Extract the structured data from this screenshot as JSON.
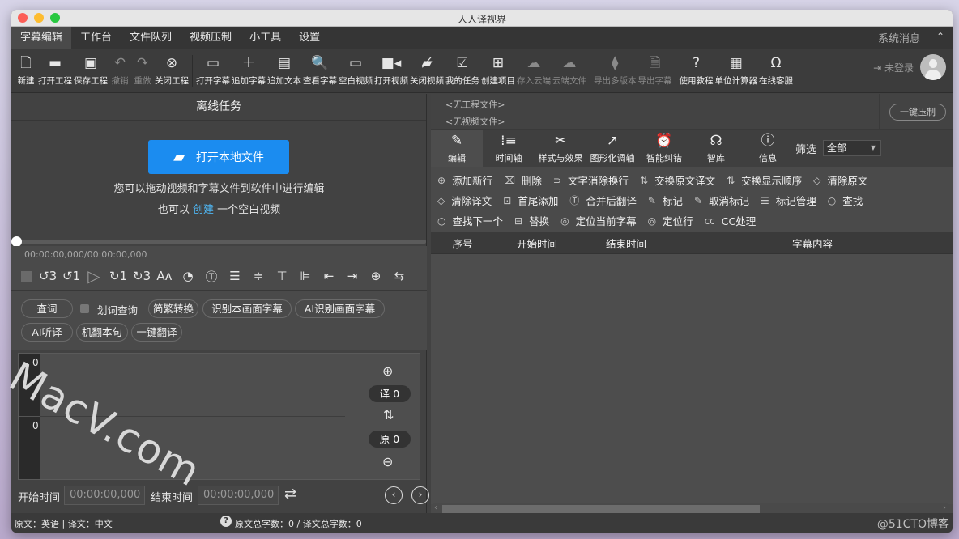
{
  "window": {
    "title": "人人译视界"
  },
  "menubar": {
    "items": [
      "字幕编辑",
      "工作台",
      "文件队列",
      "视频压制",
      "小工具",
      "设置"
    ],
    "active": "字幕编辑",
    "system_message": "系统消息",
    "collapse_icon": "chevron-up"
  },
  "toolbar": {
    "items": [
      {
        "label": "新建",
        "icon": "new-file",
        "enabled": true
      },
      {
        "label": "打开工程",
        "icon": "folder",
        "enabled": true
      },
      {
        "label": "保存工程",
        "icon": "save",
        "enabled": true
      },
      {
        "label": "撤销",
        "icon": "undo",
        "enabled": false
      },
      {
        "label": "重做",
        "icon": "redo",
        "enabled": false
      },
      {
        "label": "关闭工程",
        "icon": "close-circle",
        "enabled": true
      },
      {
        "label": "打开字幕",
        "icon": "folder-open",
        "enabled": true
      },
      {
        "label": "追加字幕",
        "icon": "plus",
        "enabled": true
      },
      {
        "label": "追加文本",
        "icon": "document",
        "enabled": true
      },
      {
        "label": "查看字幕",
        "icon": "search-doc",
        "enabled": true
      },
      {
        "label": "空白视频",
        "icon": "blank-screen",
        "enabled": true
      },
      {
        "label": "打开视频",
        "icon": "video-camera",
        "enabled": true
      },
      {
        "label": "关闭视频",
        "icon": "video-off",
        "enabled": true
      },
      {
        "label": "我的任务",
        "icon": "clipboard-check",
        "enabled": true
      },
      {
        "label": "创建项目",
        "icon": "add-box",
        "enabled": true
      },
      {
        "label": "存入云端",
        "icon": "cloud",
        "enabled": false
      },
      {
        "label": "云端文件",
        "icon": "cloud-upload",
        "enabled": false
      },
      {
        "label": "导出多版本",
        "icon": "layers-export",
        "enabled": false
      },
      {
        "label": "导出字幕",
        "icon": "file-export",
        "enabled": false
      },
      {
        "label": "使用教程",
        "icon": "help",
        "enabled": true
      },
      {
        "label": "单位计算器",
        "icon": "calculator",
        "enabled": true
      },
      {
        "label": "在线客服",
        "icon": "headset",
        "enabled": true
      }
    ],
    "login_label": "未登录"
  },
  "left": {
    "header": "离线任务",
    "open_button": "打开本地文件",
    "hint1": "您可以拖动视频和字幕文件到软件中进行编辑",
    "hint2_prefix": "也可以",
    "hint2_link": "创建",
    "hint2_suffix": "一个空白视频",
    "playback_progress": 0,
    "timecode": "00:00:00,000/00:00:00,000",
    "controls": [
      "stop",
      "back-3s",
      "back-1s",
      "play",
      "forward-1s",
      "forward-3s",
      "font-size",
      "clock",
      "text-style",
      "align-settings",
      "align-center-v",
      "align-top",
      "align-left",
      "shift-left",
      "shift-right",
      "target",
      "swap"
    ],
    "control_glyphs": [
      "",
      "↺3",
      "↺1",
      "▷",
      "↻1",
      "↻3",
      "Aᴀ",
      "◔",
      "Ⓣ",
      "☰",
      "≑",
      "⊤",
      "⊫",
      "⇤",
      "⇥",
      "⊕",
      "⇆"
    ],
    "buttons": {
      "lookup": "查词",
      "select_lookup": "划词查询",
      "simp_trad": "简繁转换",
      "recognize_frame": "识别本画面字幕",
      "ai_recognize": "AI识别画面字幕",
      "ai_listen": "AI听译",
      "mt_sentence": "机翻本句",
      "one_click_translate": "一键翻译"
    },
    "waveform": {
      "top_value": "0",
      "bottom_value": "0",
      "trans_count": "译 0",
      "orig_count": "原 0"
    },
    "start_label": "开始时间",
    "start_value": "00:00:00,000",
    "end_label": "结束时间",
    "end_value": "00:00:00,000"
  },
  "right": {
    "project_file": "<无工程文件>",
    "video_file": "<无视频文件>",
    "compress_button": "一键压制",
    "tabs": [
      {
        "label": "编辑",
        "icon": "✎"
      },
      {
        "label": "时间轴",
        "icon": "⁞≡"
      },
      {
        "label": "样式与效果",
        "icon": "✂"
      },
      {
        "label": "图形化调轴",
        "icon": "↗"
      },
      {
        "label": "智能纠错",
        "icon": "⏰"
      },
      {
        "label": "智库",
        "icon": "☊"
      },
      {
        "label": "信息",
        "icon": "ⓘ"
      }
    ],
    "active_tab": "编辑",
    "filter_label": "筛选",
    "filter_value": "全部",
    "actions": [
      [
        {
          "label": "添加新行",
          "icon": "⊕"
        },
        {
          "label": "删除",
          "icon": "🗑"
        },
        {
          "label": "文字消除换行",
          "icon": "⊃"
        },
        {
          "label": "交换原文译文",
          "icon": "⇅"
        },
        {
          "label": "交换显示顺序",
          "icon": "⇅"
        },
        {
          "label": "清除原文",
          "icon": "◇"
        }
      ],
      [
        {
          "label": "清除译文",
          "icon": "◇"
        },
        {
          "label": "首尾添加",
          "icon": "⊡"
        },
        {
          "label": "合并后翻译",
          "icon": "Ⓣ"
        },
        {
          "label": "标记",
          "icon": "✎"
        },
        {
          "label": "取消标记",
          "icon": "✎"
        },
        {
          "label": "标记管理",
          "icon": "☰"
        },
        {
          "label": "查找",
          "icon": "○"
        }
      ],
      [
        {
          "label": "查找下一个",
          "icon": "○"
        },
        {
          "label": "替换",
          "icon": "⊟"
        },
        {
          "label": "定位当前字幕",
          "icon": "◎"
        },
        {
          "label": "定位行",
          "icon": "◎"
        },
        {
          "label": "CC处理",
          "icon": "cc"
        }
      ]
    ],
    "table": {
      "columns": [
        "序号",
        "开始时间",
        "结束时间",
        "字幕内容"
      ],
      "rows": []
    }
  },
  "statusbar": {
    "languages": "原文：英语 | 译文：中文",
    "counts": "原文总字数：0 / 译文总字数：0"
  },
  "overlay": {
    "watermark": "MacV.com",
    "blog_credit": "@51CTO博客"
  }
}
